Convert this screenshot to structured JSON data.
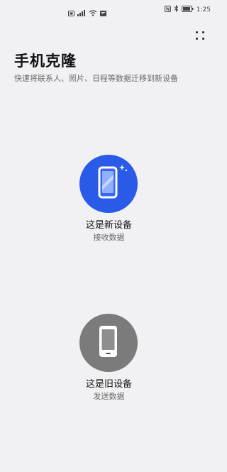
{
  "status_bar": {
    "time": "1:25",
    "icons": [
      "sim-icon",
      "signal-icon",
      "wifi-icon",
      "notification-icon",
      "nfc-icon",
      "bluetooth-icon",
      "battery-icon"
    ]
  },
  "header": {
    "title": "手机克隆",
    "subtitle": "快速将联系人、照片、日程等数据迁移到新设备",
    "more_icon": "more-dots-icon"
  },
  "options": [
    {
      "title": "这是新设备",
      "desc": "接收数据",
      "icon": "new-phone-icon",
      "color": "#2a5ae8"
    },
    {
      "title": "这是旧设备",
      "desc": "发送数据",
      "icon": "old-phone-icon",
      "color": "#7b7b7b"
    }
  ]
}
